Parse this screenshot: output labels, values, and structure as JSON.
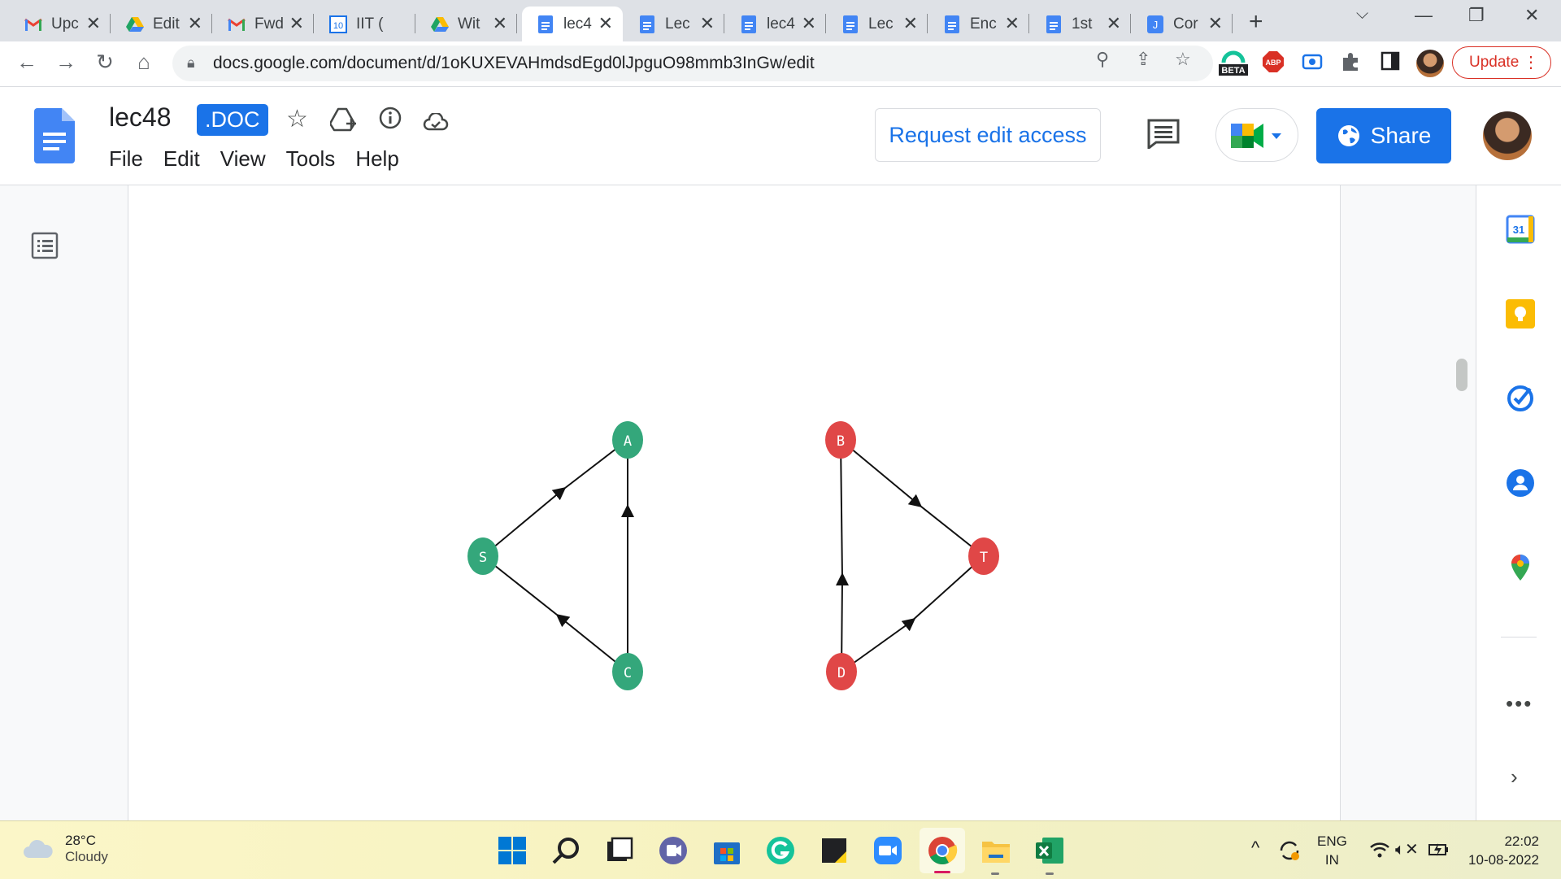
{
  "browser": {
    "tabs": [
      {
        "title": "Upc",
        "icon": "gmail-icon"
      },
      {
        "title": "Edit",
        "icon": "drive-icon"
      },
      {
        "title": "Fwd",
        "icon": "gmail-icon"
      },
      {
        "title": "IIT (",
        "icon": "calendar-icon"
      },
      {
        "title": "Wit",
        "icon": "drive-icon"
      },
      {
        "title": "lec4",
        "icon": "docs-icon",
        "active": true
      },
      {
        "title": "Lec",
        "icon": "docs-icon"
      },
      {
        "title": "lec4",
        "icon": "docs-icon"
      },
      {
        "title": "Lec",
        "icon": "docs-icon"
      },
      {
        "title": "Enc",
        "icon": "docs-icon"
      },
      {
        "title": "1st",
        "icon": "docs-icon"
      },
      {
        "title": "Cor",
        "icon": "jamboard-icon"
      }
    ],
    "url": "docs.google.com/document/d/1oKUXEVAHmdsdEgd0lJpguO98mmb3InGw/edit",
    "update_label": "Update",
    "beta_label": "BETA",
    "abp_label": "ABP"
  },
  "docs": {
    "title": "lec48",
    "badge": ".DOC",
    "menu": [
      "File",
      "Edit",
      "View",
      "Tools",
      "Help"
    ],
    "request_edit_label": "Request edit access",
    "share_label": "Share"
  },
  "diagram": {
    "left_nodes": [
      {
        "id": "A",
        "color": "#34a77b"
      },
      {
        "id": "S",
        "color": "#34a77b"
      },
      {
        "id": "C",
        "color": "#34a77b"
      }
    ],
    "right_nodes": [
      {
        "id": "B",
        "color": "#e04747"
      },
      {
        "id": "T",
        "color": "#e04747"
      },
      {
        "id": "D",
        "color": "#e04747"
      }
    ],
    "edges": [
      {
        "from": "S",
        "to": "A"
      },
      {
        "from": "C",
        "to": "A"
      },
      {
        "from": "C",
        "to": "S"
      },
      {
        "from": "B",
        "to": "T"
      },
      {
        "from": "D",
        "to": "B"
      },
      {
        "from": "D",
        "to": "T"
      }
    ]
  },
  "side_panel": {
    "calendar_day": "31",
    "icons": [
      "calendar-icon",
      "keep-icon",
      "tasks-icon",
      "contacts-icon",
      "maps-icon",
      "more-icon",
      "expand-icon"
    ]
  },
  "taskbar": {
    "weather_temp": "28°C",
    "weather_cond": "Cloudy",
    "lang_top": "ENG",
    "lang_bottom": "IN",
    "time": "22:02",
    "date": "10-08-2022"
  }
}
